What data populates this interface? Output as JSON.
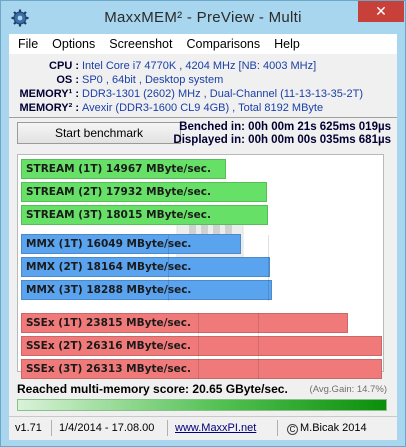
{
  "window": {
    "title": "MaxxMEM² - PreView - Multi",
    "close_glyph": "✕",
    "icon": "gear-icon"
  },
  "menu": [
    "File",
    "Options",
    "Screenshot",
    "Comparisons",
    "Help"
  ],
  "info": [
    {
      "label": "CPU :",
      "value": "Intel Core i7 4770K , 4204 MHz  [NB: 4003 MHz]"
    },
    {
      "label": "OS :",
      "value": "SP0 , 64bit , Desktop system"
    },
    {
      "label": "MEMORY¹ :",
      "value": "DDR3-1301 (2602) MHz , Dual-Channel (11-13-13-35-2T)"
    },
    {
      "label": "MEMORY² :",
      "value": "Avexir (DDR3-1600 CL9 4GB) , Total 8192 MByte"
    }
  ],
  "benchmark": {
    "start_label": "Start benchmark",
    "benched": "Benched in: 00h 00m 21s 625ms 019µs",
    "displayed": "Displayed in: 00h 00m 00s 035ms 681µs"
  },
  "bars": [
    {
      "group": "stream",
      "label": "STREAM (1T)  14967 MByte/sec.",
      "value": 14967,
      "color": "#66e066"
    },
    {
      "group": "stream",
      "label": "STREAM (2T)  17932 MByte/sec.",
      "value": 17932,
      "color": "#66e066"
    },
    {
      "group": "stream",
      "label": "STREAM (3T)  18015 MByte/sec.",
      "value": 18015,
      "color": "#66e066"
    },
    {
      "group": "mmx",
      "label": "MMX (1T)  16049 MByte/sec.",
      "value": 16049,
      "color": "#5aa3ee"
    },
    {
      "group": "mmx",
      "label": "MMX (2T)  18164 MByte/sec.",
      "value": 18164,
      "color": "#5aa3ee"
    },
    {
      "group": "mmx",
      "label": "MMX (3T)  18288 MByte/sec.",
      "value": 18288,
      "color": "#5aa3ee"
    },
    {
      "group": "ssex",
      "label": "SSEx (1T)  23815 MByte/sec.",
      "value": 23815,
      "color": "#f07a7a"
    },
    {
      "group": "ssex",
      "label": "SSEx (2T)  26316 MByte/sec.",
      "value": 26316,
      "color": "#f07a7a"
    },
    {
      "group": "ssex",
      "label": "SSEx (3T)  26313 MByte/sec.",
      "value": 26313,
      "color": "#f07a7a"
    }
  ],
  "bar_scale_max": 26316,
  "watermark": {
    "text": "legend",
    "icon": "iw-logo-icon"
  },
  "score": {
    "text": "Reached multi-memory score: 20.65 GByte/sec.",
    "avg_gain": "(Avg.Gain: 14.7%)",
    "progress_fraction": 1.0
  },
  "status": {
    "version": "v1.71",
    "date": "1/4/2014 - 17.08.00",
    "url": "www.MaxxPI.net",
    "copyright_glyph": "C",
    "author": "M.Bicak 2014"
  }
}
